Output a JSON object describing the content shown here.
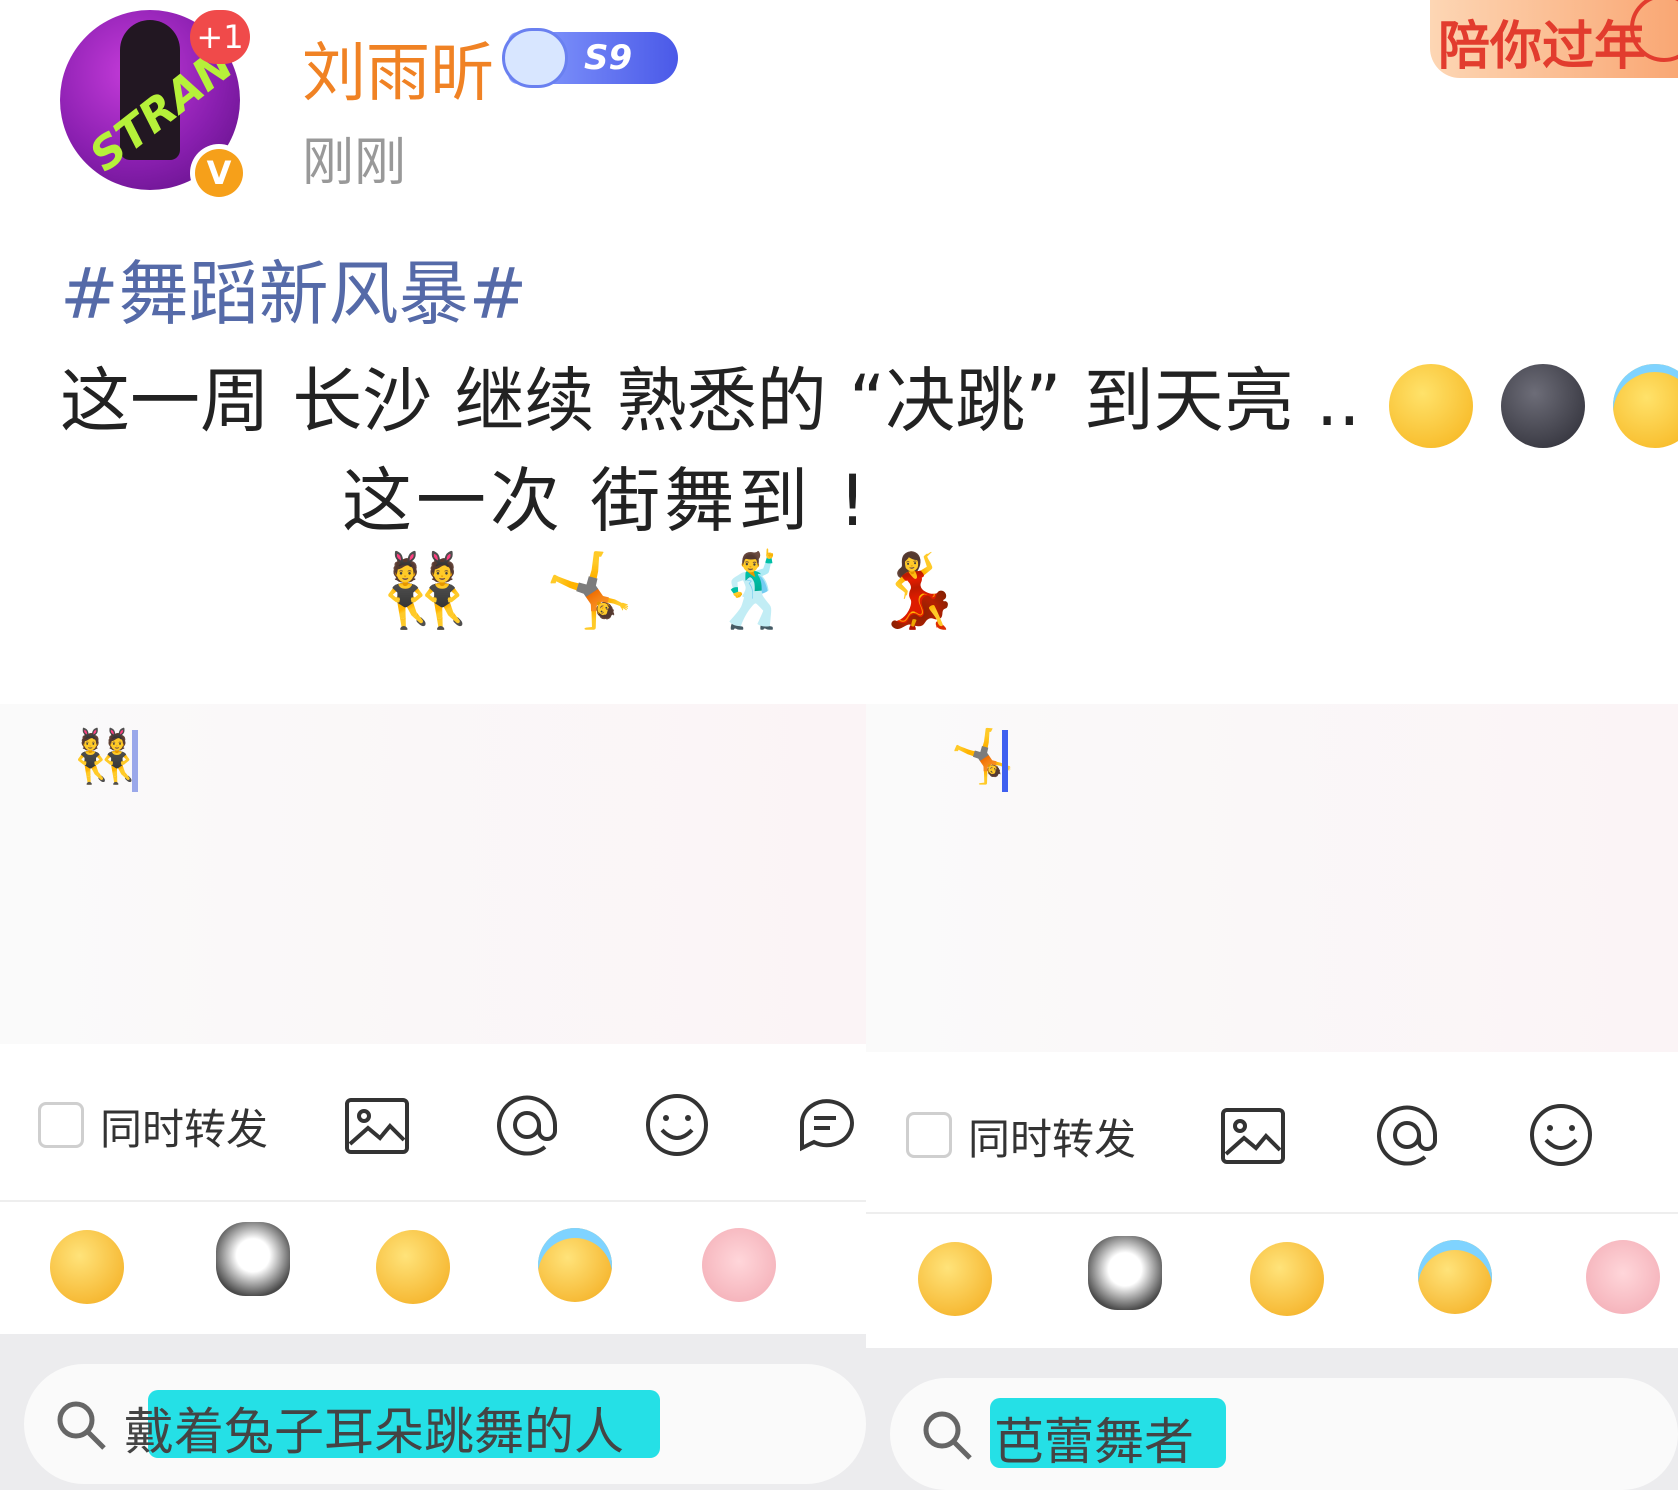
{
  "header": {
    "username": "刘雨昕",
    "level_badge": "S9",
    "timestamp": "刚刚",
    "notification_badge": "+1",
    "verified_badge": "V",
    "promo_banner": "陪你过年"
  },
  "post": {
    "hashtag": "#舞蹈新风暴#",
    "line1": "这一周 长沙 继续 熟悉的 “决跳” 到天亮 ..",
    "line1_emojis": [
      "surprised-face",
      "new-moon-face",
      "angel-flower-face"
    ],
    "line2": "这一次  街舞到 !",
    "dancer_emojis": [
      "👯",
      "🤸",
      "🕺",
      "💃"
    ]
  },
  "compose_left": {
    "content_emoji": "👯",
    "repost_label": "同时转发",
    "toolbar_icons": [
      "image-icon",
      "mention-icon",
      "emoji-icon",
      "chat-icon"
    ],
    "stickers": [
      "pleading-face",
      "cat-heart-face",
      "drooling-face",
      "angel-face",
      "pig-face"
    ],
    "search_query": "戴着兔子耳朵跳舞的人"
  },
  "compose_right": {
    "content_emoji": "🤸",
    "repost_label": "同时转发",
    "toolbar_icons": [
      "image-icon",
      "mention-icon",
      "emoji-icon"
    ],
    "stickers": [
      "pleading-face",
      "cat-heart-face",
      "drooling-face",
      "angel-face",
      "pig-face"
    ],
    "search_query": "芭蕾舞者"
  },
  "colors": {
    "username": "#f08224",
    "hashtag": "#556aa8",
    "highlight": "#25e0e6",
    "cursor_active": "#3f60f0"
  }
}
